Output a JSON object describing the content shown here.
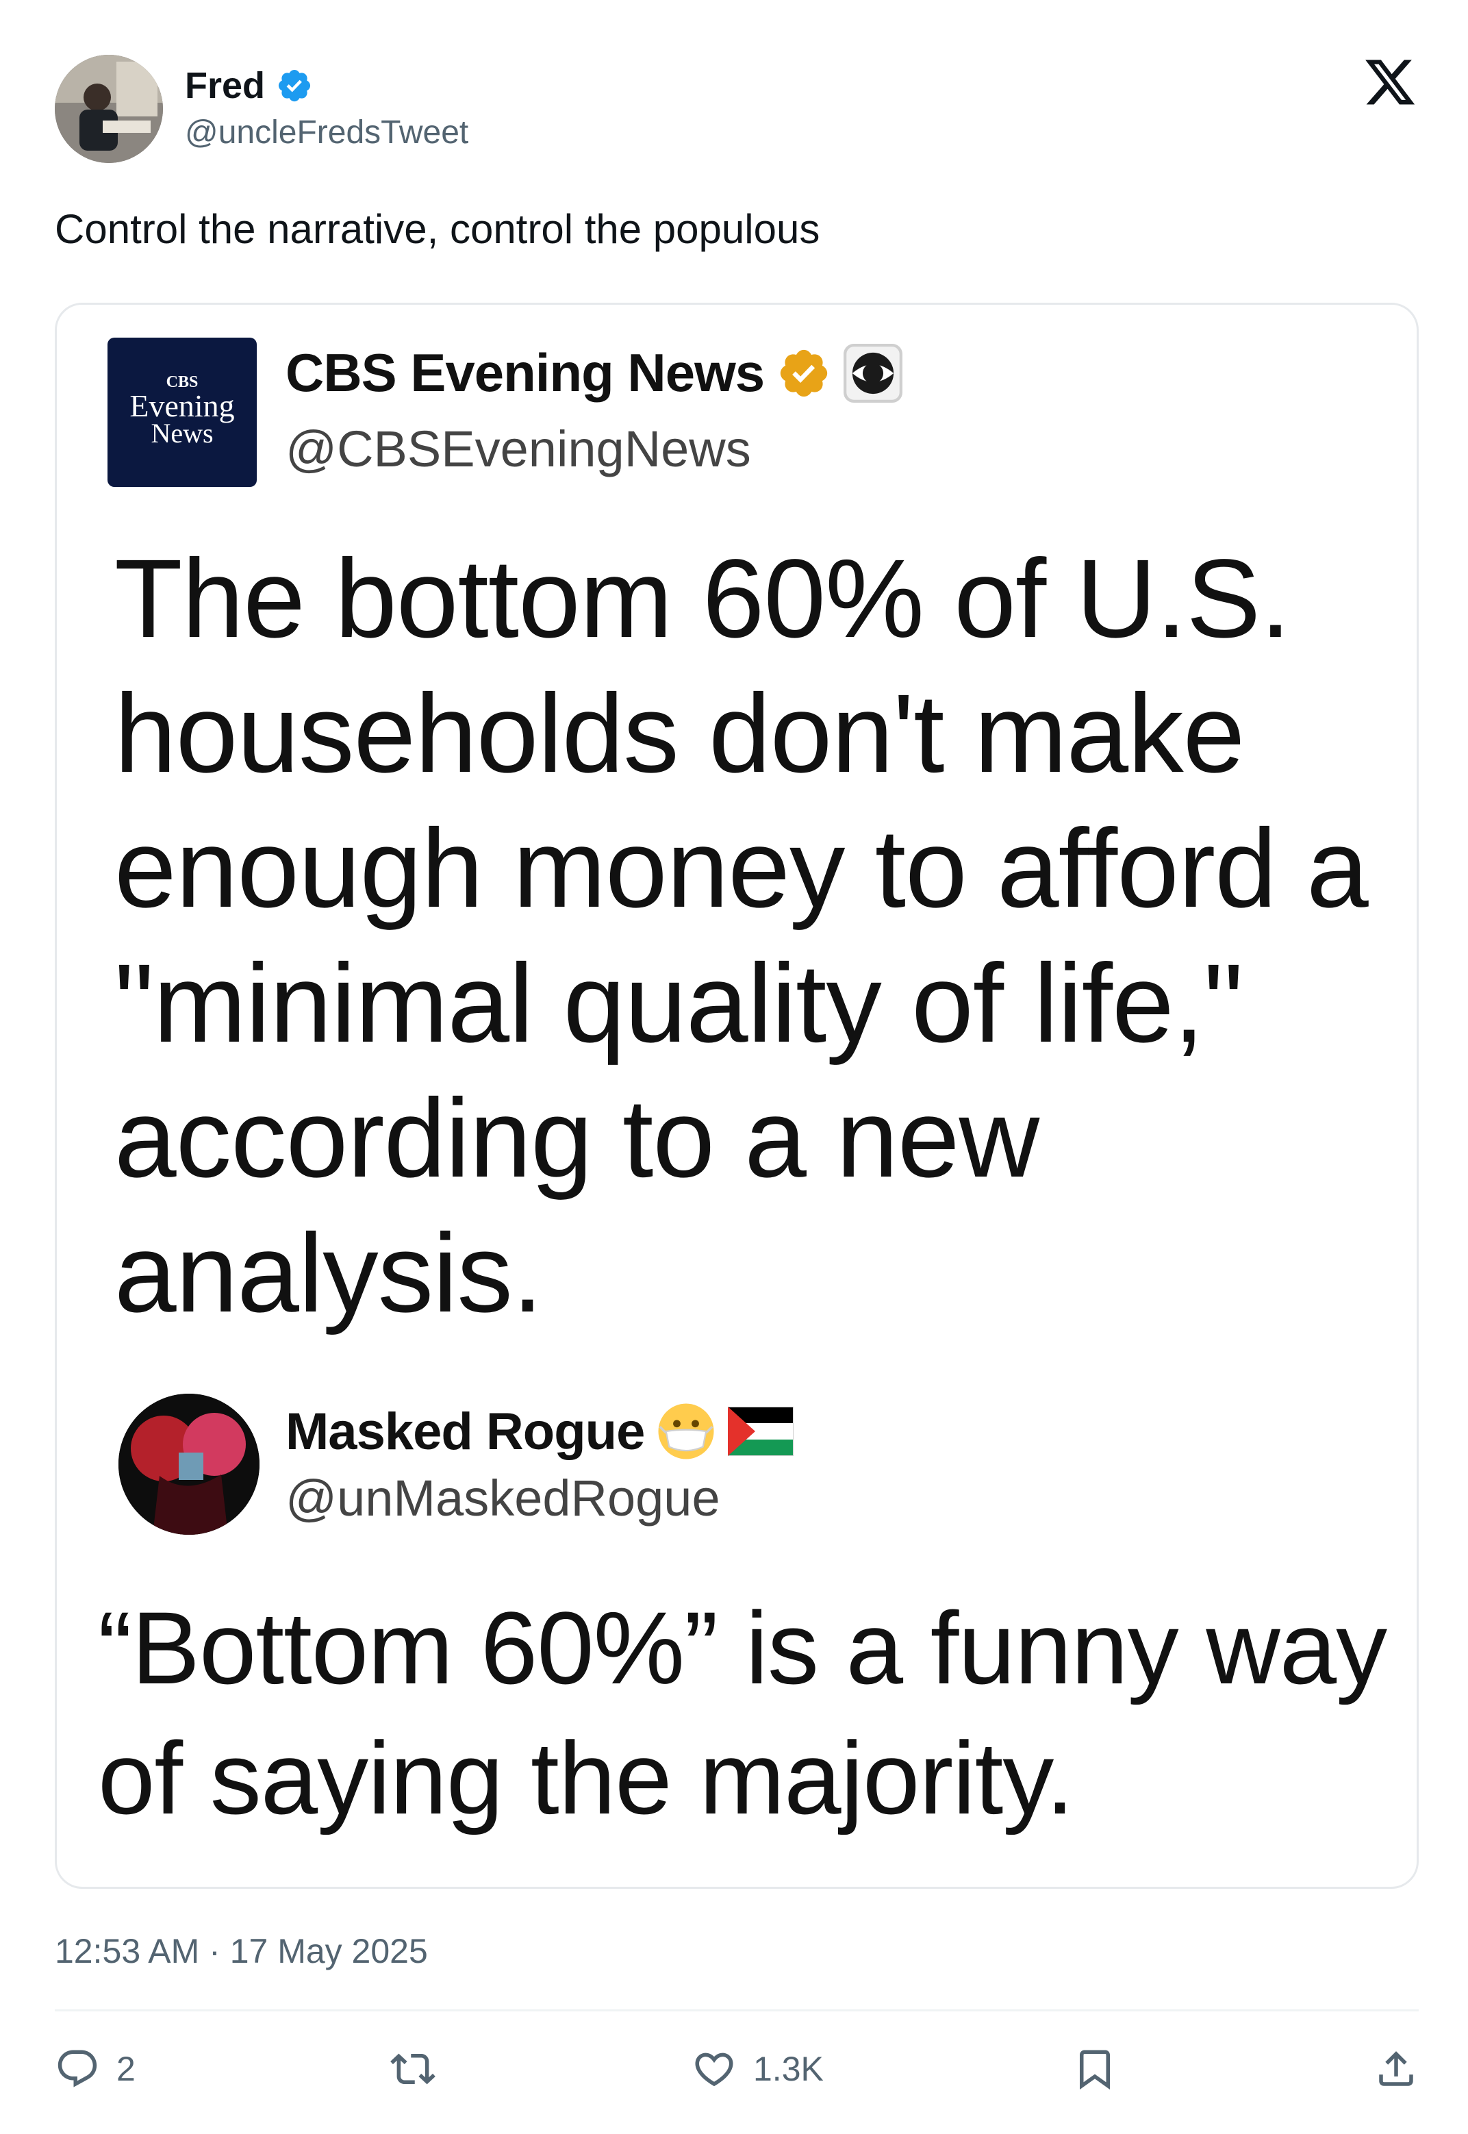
{
  "author": {
    "name": "Fred",
    "handle": "@uncleFredsTweet",
    "verified_icon": "verified-badge-icon"
  },
  "brand_icon": "x-logo-icon",
  "tweet": {
    "text": "Control the narrative, control the populous",
    "timestamp": "12:53 AM · 17 May 2025"
  },
  "embedded": {
    "source": {
      "name": "CBS Evening News",
      "handle": "@CBSEveningNews",
      "logo_line1": "CBS",
      "logo_line2": "Evening",
      "logo_line3": "News"
    },
    "headline": "The bottom 60% of U.S. households don't make enough money to afford a \"minimal quality of life,\" according to a new analysis.",
    "reply": {
      "name": "Masked Rogue",
      "handle": "@unMaskedRogue",
      "text": "“Bottom 60%” is a funny way of saying the majority."
    }
  },
  "actions": {
    "replies": "2",
    "reposts": "",
    "likes": "1.3K"
  },
  "colors": {
    "verified_blue": "#1d9bf0",
    "gold_badge": "#e8a317",
    "muted_text": "#536471",
    "cbs_navy": "#0b1840"
  }
}
